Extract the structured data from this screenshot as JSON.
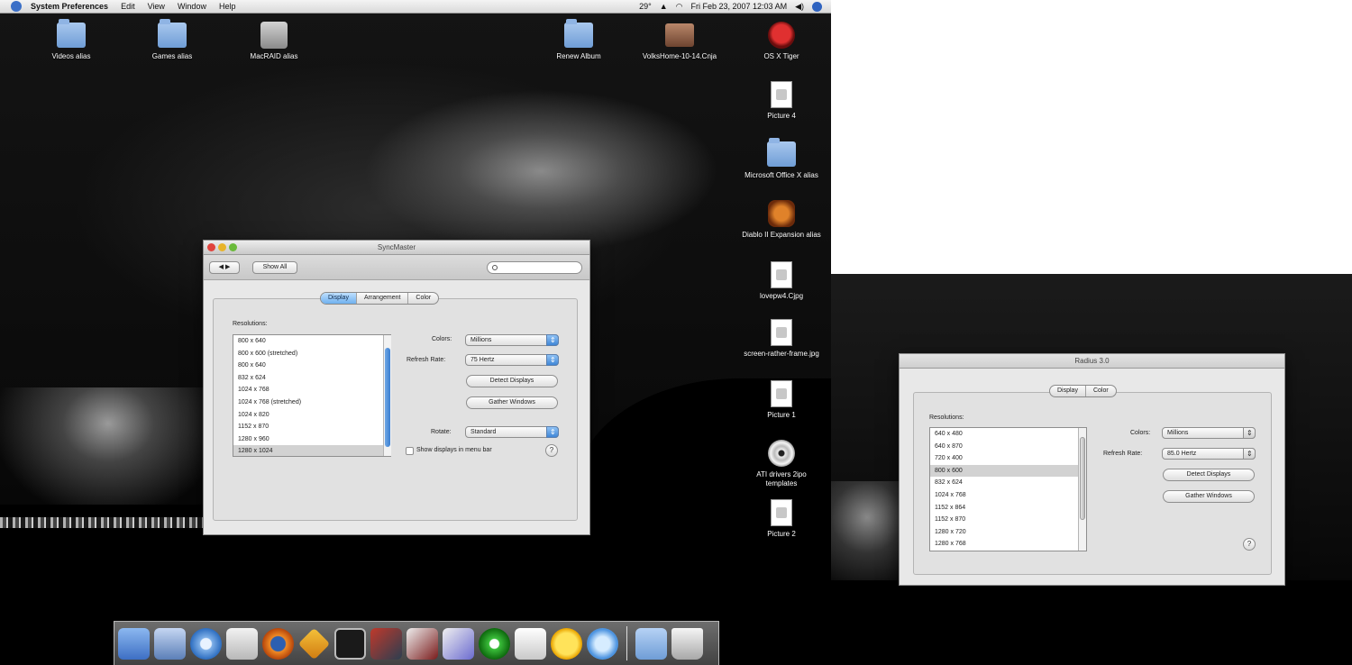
{
  "menubar": {
    "app_name": "System Preferences",
    "items": [
      "Edit",
      "View",
      "Window",
      "Help"
    ],
    "temperature": "29°",
    "clock": "Fri Feb 23, 2007  12:03 AM"
  },
  "desktop_icons": {
    "top_row": [
      {
        "label": "Videos alias",
        "icon": "folder-icon"
      },
      {
        "label": "Games alias",
        "icon": "folder-icon"
      },
      {
        "label": "MacRAID alias",
        "icon": "hard-drive-icon"
      },
      {
        "label": "Renew Album",
        "icon": "folder-icon"
      },
      {
        "label": "VolksHome-10-14.Cnja",
        "icon": "package-icon"
      }
    ],
    "right_column": [
      {
        "label": "OS X Tiger",
        "icon": "os-disc-icon"
      },
      {
        "label": "Picture 4",
        "icon": "document-icon"
      },
      {
        "label": "Microsoft Office X alias",
        "icon": "folder-icon"
      },
      {
        "label": "Diablo II Expansion alias",
        "icon": "game-icon"
      },
      {
        "label": "lovepw4.Cjpg",
        "icon": "document-icon"
      },
      {
        "label": "screen-rather-frame.jpg",
        "icon": "document-icon"
      },
      {
        "label": "Picture 1",
        "icon": "document-icon"
      },
      {
        "label": "ATI drivers 2ipo templates",
        "icon": "disc-icon"
      },
      {
        "label": "Picture 2",
        "icon": "document-icon"
      }
    ]
  },
  "main_window": {
    "title": "SyncMaster",
    "show_all": "Show All",
    "nav_back": "◀",
    "nav_fwd": "▶",
    "search_placeholder": "",
    "tabs": [
      {
        "label": "Display",
        "active": true
      },
      {
        "label": "Arrangement",
        "active": false
      },
      {
        "label": "Color",
        "active": false
      }
    ],
    "resolutions_label": "Resolutions:",
    "resolutions": [
      "800 x 640",
      "800 x 600 (stretched)",
      "800 x 640",
      "832 x 624",
      "1024 x 768",
      "1024 x 768 (stretched)",
      "1024 x 820",
      "1152 x 870",
      "1280 x 960",
      "1280 x 1024"
    ],
    "selected_resolution": "1280 x 1024",
    "colors_label": "Colors:",
    "colors_value": "Millions",
    "refresh_label": "Refresh Rate:",
    "refresh_value": "75 Hertz",
    "detect_displays": "Detect Displays",
    "gather_windows": "Gather Windows",
    "rotate_label": "Rotate:",
    "rotate_value": "Standard",
    "show_menubar_label": "Show displays in menu bar",
    "help_glyph": "?"
  },
  "second_window": {
    "title": "Radius 3.0",
    "tabs": [
      {
        "label": "Display",
        "active": false
      },
      {
        "label": "Color",
        "active": false
      }
    ],
    "resolutions_label": "Resolutions:",
    "resolutions": [
      "640 x 480",
      "640 x 870",
      "720 x 400",
      "800 x 600",
      "832 x 624",
      "1024 x 768",
      "1152 x 864",
      "1152 x 870",
      "1280 x 720",
      "1280 x 768"
    ],
    "selected_resolution": "800 x 600",
    "colors_label": "Colors:",
    "colors_value": "Millions",
    "refresh_label": "Refresh Rate:",
    "refresh_value": "85.0 Hertz",
    "detect_displays": "Detect Displays",
    "gather_windows": "Gather Windows",
    "help_glyph": "?"
  },
  "dock": {
    "items": [
      "finder-icon",
      "preview-icon",
      "itunes-icon",
      "mail-icon",
      "firefox-icon",
      "adium-icon",
      "terminal-icon",
      "photo-booth-icon",
      "tools-icon",
      "app-icon",
      "dreamweaver-icon",
      "textedit-icon",
      "smiley-icon",
      "ichat-icon"
    ],
    "right_items": [
      "folder-icon",
      "trash-icon"
    ]
  }
}
